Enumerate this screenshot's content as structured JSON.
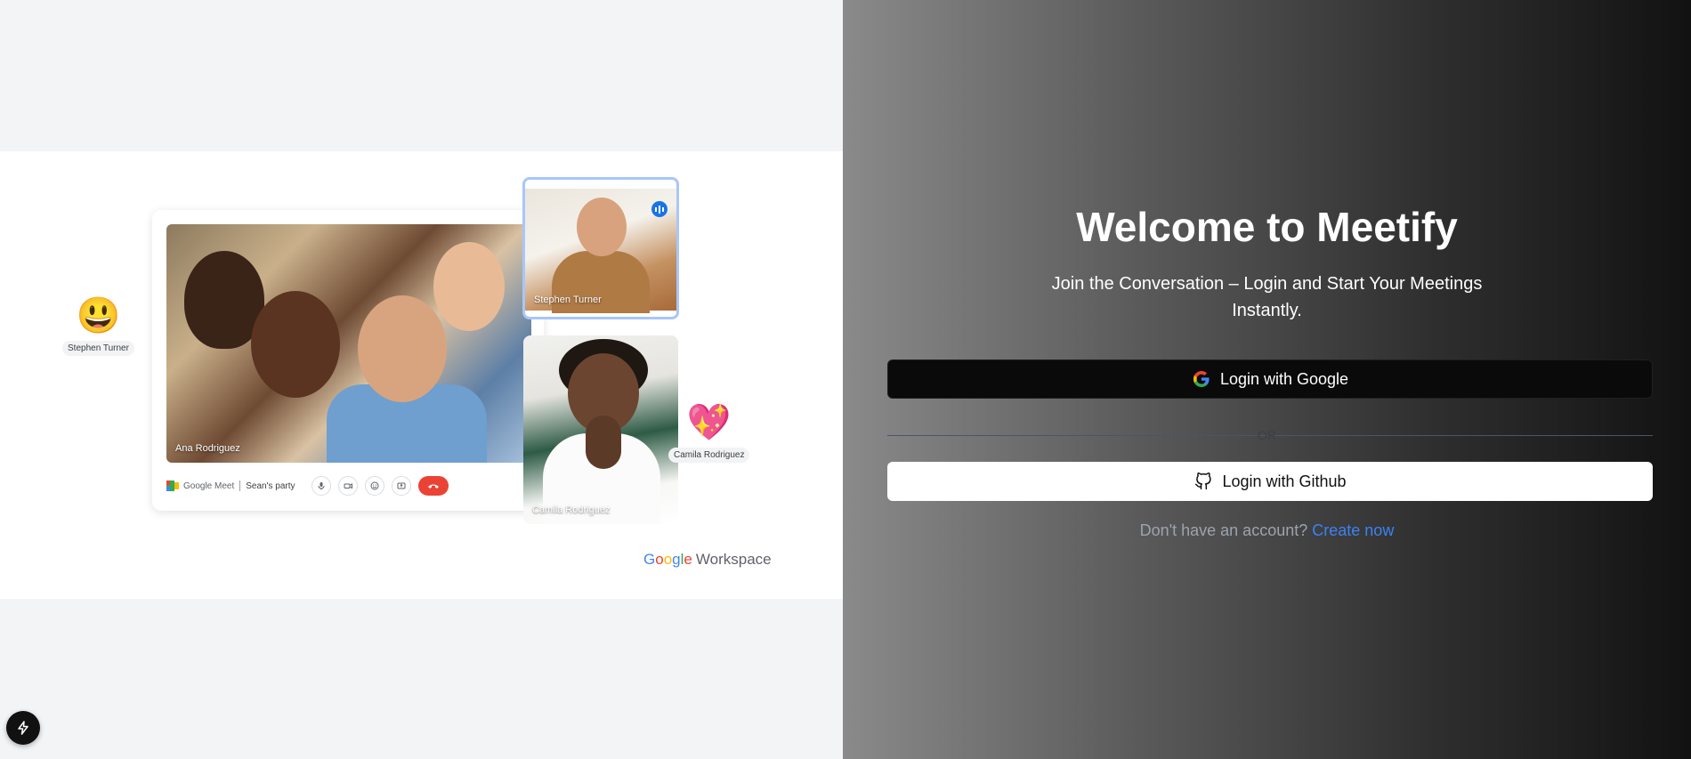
{
  "left_panel": {
    "reactions": [
      {
        "emoji": "😃",
        "name": "Stephen Turner",
        "icon": "smiley-emoji-icon"
      },
      {
        "emoji": "💖",
        "name": "Camila Rodriguez",
        "icon": "sparkling-heart-emoji-icon"
      }
    ],
    "main_video": {
      "participant": "Ana Rodriguez"
    },
    "tiles": [
      {
        "participant": "Stephen Turner",
        "speaking": true
      },
      {
        "participant": "Camila Rodriguez"
      }
    ],
    "controls": {
      "brand": "Google Meet",
      "meeting_title": "Sean's party",
      "icons": [
        "microphone-icon",
        "camera-icon",
        "emoji-icon",
        "present-icon",
        "end-call-icon"
      ]
    },
    "workspace_logo": {
      "google": "Google",
      "word": "Workspace"
    },
    "colors": {
      "google_blue": "#4285F4",
      "google_red": "#EA4335",
      "google_yellow": "#FBBC05",
      "google_green": "#34A853",
      "speaking_blue": "#1A73E8"
    }
  },
  "right_panel": {
    "title": "Welcome to Meetify",
    "subtitle": "Join the Conversation – Login and Start Your Meetings Instantly.",
    "google_button_label": "Login with Google",
    "divider_text": "OR",
    "github_button_label": "Login with Github",
    "signup_prompt": "Don't have an account?",
    "signup_link": "Create now",
    "colors": {
      "link": "#3B82F6",
      "google_button_bg": "#0A0A0A",
      "github_button_bg": "#FFFFFF"
    }
  },
  "floating_button": {
    "icon": "lightning-bolt-icon"
  }
}
